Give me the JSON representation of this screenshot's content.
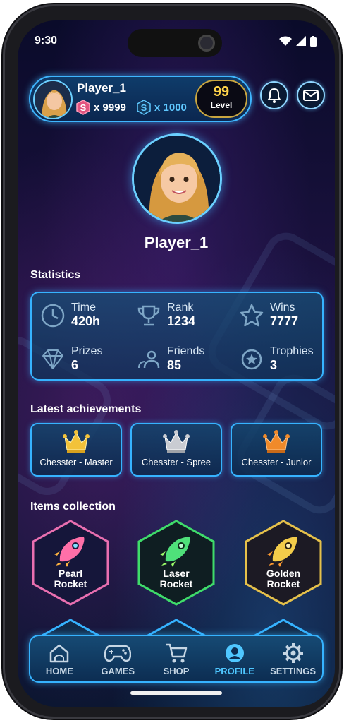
{
  "status": {
    "time": "9:30"
  },
  "header": {
    "player_name": "Player_1",
    "currency_pink": "x 9999",
    "currency_blue": "x 1000",
    "level_value": "99",
    "level_label": "Level"
  },
  "profile": {
    "player_name": "Player_1"
  },
  "statistics": {
    "title": "Statistics",
    "items": [
      {
        "label": "Time",
        "value": "420h",
        "icon": "clock-icon"
      },
      {
        "label": "Rank",
        "value": "1234",
        "icon": "trophy-icon"
      },
      {
        "label": "Wins",
        "value": "7777",
        "icon": "star-icon"
      },
      {
        "label": "Prizes",
        "value": "6",
        "icon": "diamond-icon"
      },
      {
        "label": "Friends",
        "value": "85",
        "icon": "friends-icon"
      },
      {
        "label": "Trophies",
        "value": "3",
        "icon": "medal-icon"
      }
    ]
  },
  "achievements": {
    "title": "Latest achievements",
    "items": [
      {
        "label": "Chesster - Master",
        "color": "#f2c23a"
      },
      {
        "label": "Chesster - Spree",
        "color": "#c9ccd2"
      },
      {
        "label": "Chesster - Junior",
        "color": "#f08a2a"
      }
    ]
  },
  "collection": {
    "title": "Items collection",
    "items": [
      {
        "name_line1": "Pearl",
        "name_line2": "Rocket",
        "border": "#e96fb0"
      },
      {
        "name_line1": "Laser",
        "name_line2": "Rocket",
        "border": "#3fdc6a"
      },
      {
        "name_line1": "Golden",
        "name_line2": "Rocket",
        "border": "#e6c14a"
      }
    ]
  },
  "nav": {
    "items": [
      {
        "label": "HOME",
        "icon": "home-icon"
      },
      {
        "label": "GAMES",
        "icon": "gamepad-icon"
      },
      {
        "label": "SHOP",
        "icon": "cart-icon"
      },
      {
        "label": "PROFILE",
        "icon": "profile-icon",
        "active": true
      },
      {
        "label": "SETTINGS",
        "icon": "gear-icon"
      }
    ]
  }
}
